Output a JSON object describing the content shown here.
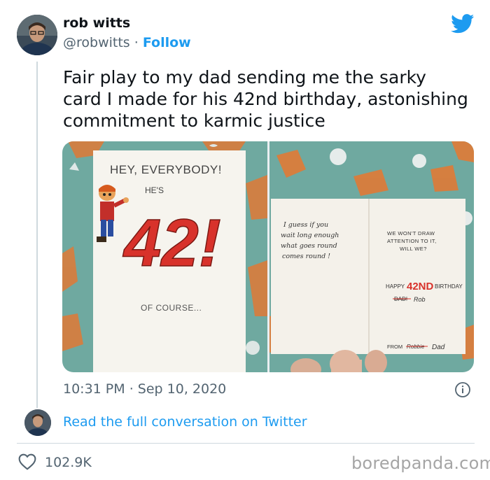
{
  "author": {
    "name": "rob witts",
    "handle": "@robwitts",
    "separator": "·",
    "follow_label": "Follow"
  },
  "tweet": {
    "text": "Fair play to my dad sending me the sarky card I made for his 42nd birthday, astonishing commitment to karmic justice",
    "time": "10:31 PM",
    "date_separator": "·",
    "date": "Sep 10, 2020"
  },
  "card_left": {
    "heading": "HEY, EVERYBODY!",
    "hes": "HE'S",
    "number": "42!",
    "footer": "OF COURSE..."
  },
  "card_right": {
    "left_lines": [
      "I guess if you",
      "wait long enough",
      "what goes round",
      "comes round !"
    ],
    "right_lines": [
      "WE WON'T DRAW",
      "ATTENTION TO IT,",
      "WILL WE?"
    ],
    "happy_prefix": "HAPPY",
    "happy_number": "42ND",
    "happy_suffix": "BIRTHDAY",
    "signature_struck": "DAD!",
    "signature": "Rob",
    "from_label": "FROM",
    "from_struck": "Robbie",
    "from_name": "Dad"
  },
  "conversation_link": "Read the full conversation on Twitter",
  "likes": "102.9K",
  "watermark": "boredpanda.com",
  "colors": {
    "accent": "#1d9bf0",
    "text": "#0f1419",
    "muted": "#536471",
    "divider": "#cfd9de",
    "card_red": "#d8322b",
    "background_teal": "#6fa9a0"
  },
  "icons": {
    "brand": "twitter-bird-icon",
    "info": "info-circle-icon",
    "like": "heart-outline-icon"
  }
}
